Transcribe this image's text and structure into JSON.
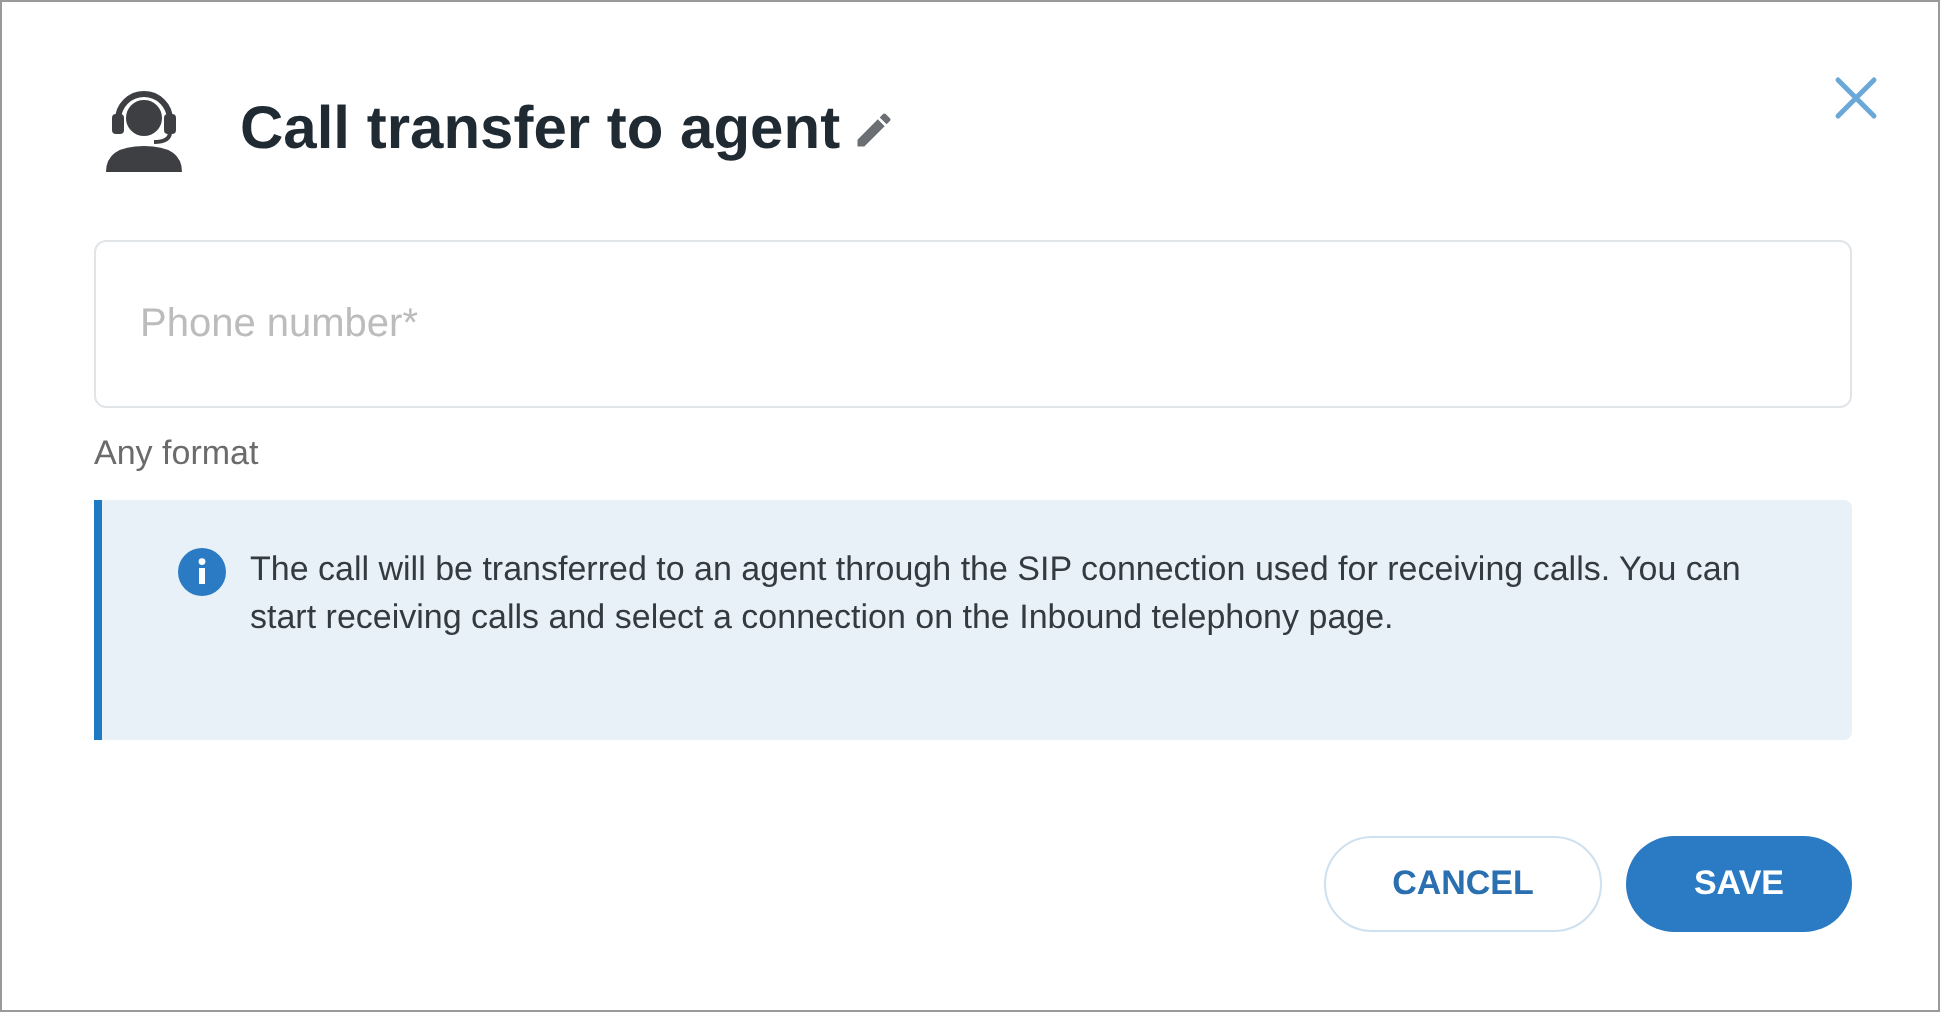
{
  "dialog": {
    "title": "Call transfer to agent"
  },
  "phone_field": {
    "placeholder": "Phone number*",
    "hint": "Any format"
  },
  "info": {
    "text": "The call will be transferred to an agent through the SIP connection used for receiving calls. You can start receiving calls and select a connection on the Inbound telephony page."
  },
  "buttons": [
    {
      "kind": "secondary",
      "label": "CANCEL"
    },
    {
      "kind": "primary",
      "label": "SAVE"
    }
  ]
}
